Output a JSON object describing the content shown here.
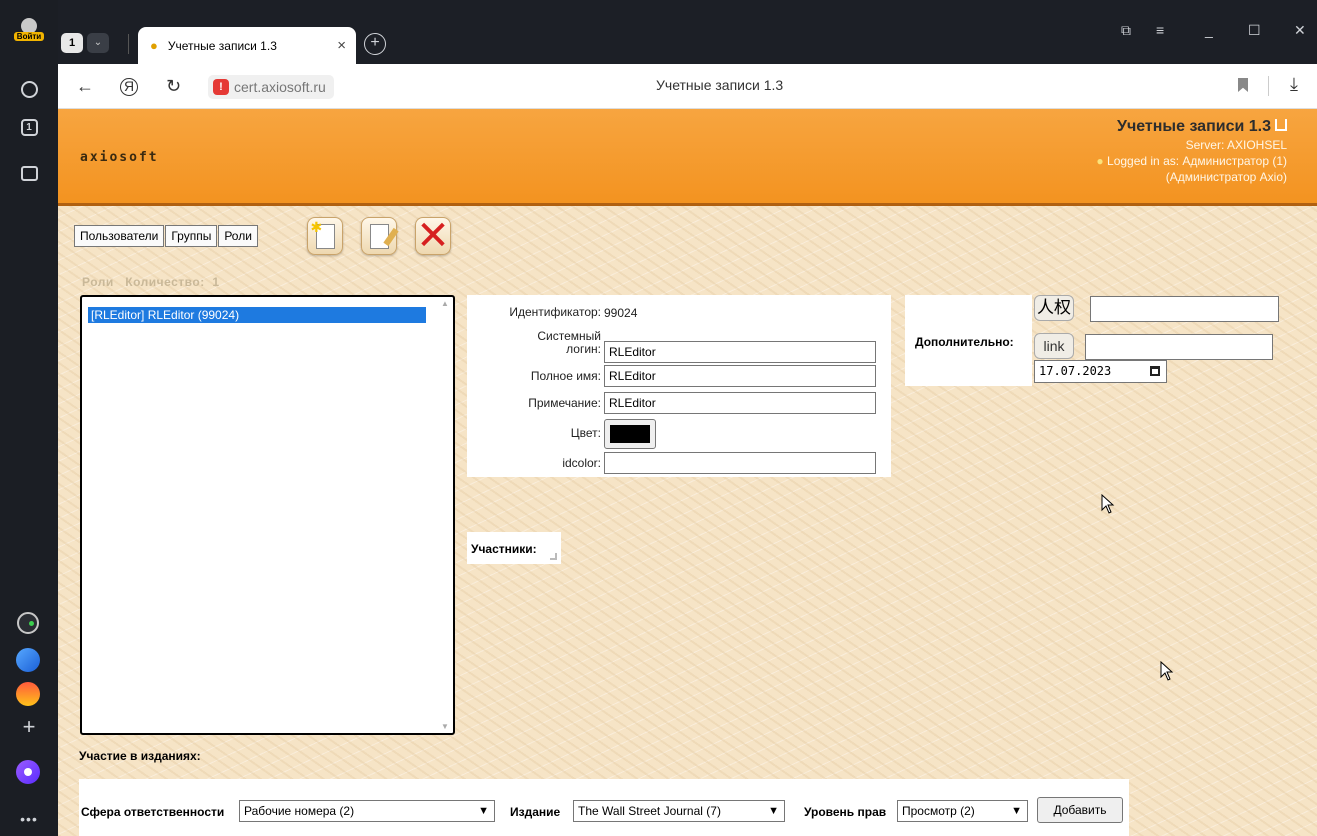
{
  "browser": {
    "sidebar": {
      "login_label": "Войти",
      "tabs_count": "1"
    },
    "tab_count": "1",
    "tab": {
      "title": "Учетные записи 1.3",
      "close": "×"
    },
    "new_tab": "+",
    "window_controls": {
      "pin": "⧉",
      "menu": "≡",
      "minimize": "_",
      "maximize": "☐",
      "close": "✕"
    },
    "address": {
      "domain": "cert.axiosoft.ru",
      "page_title": "Учетные записи 1.3"
    },
    "icons": {
      "back": "arrow-left-icon",
      "yandex": "yandex-logo-icon",
      "reload": "reload-icon",
      "warning": "warning-icon",
      "bookmark": "bookmark-icon",
      "download": "download-icon"
    }
  },
  "header": {
    "logo": "axiosoft",
    "app_title": "Учетные записи 1.3",
    "server": "Server: AXIOHSEL",
    "logged_in": "Logged in as: Администратор (1)",
    "logged_in_detail": "(Администратор Axio)"
  },
  "nav": {
    "users": "Пользователи",
    "groups": "Группы",
    "roles": "Роли"
  },
  "roles": {
    "label": "Роли",
    "count_label": "Количество:",
    "count": "1",
    "items": [
      "[RLEditor] RLEditor (99024)"
    ]
  },
  "form": {
    "id_label": "Идентификатор:",
    "id_value": "99024",
    "login_label_1": "Системный",
    "login_label_2": "логин:",
    "login_value": "RLEditor",
    "fullname_label": "Полное имя:",
    "fullname_value": "RLEditor",
    "note_label": "Примечание:",
    "note_value": "RLEditor",
    "color_label": "Цвет:",
    "color_value": "#000000",
    "idcolor_label": "idcolor:",
    "idcolor_value": ""
  },
  "extra": {
    "label": "Дополнительно:",
    "kanji_button": "人权",
    "link_button": "link",
    "date_value": "17.07.2023"
  },
  "participants": {
    "label": "Участники:"
  },
  "editions": {
    "label": "Участие в изданиях:",
    "sphere_label": "Сфера ответственности",
    "sphere_value": "Рабочие номера (2)",
    "edition_label": "Издание",
    "edition_value": "The Wall Street Journal (7)",
    "rights_label": "Уровень прав",
    "rights_value": "Просмотр (2)",
    "add_button": "Добавить"
  },
  "colors": {
    "header_orange": "#f39320",
    "selection_blue": "#1e7ae0",
    "page_bg": "#f6e4c6"
  }
}
